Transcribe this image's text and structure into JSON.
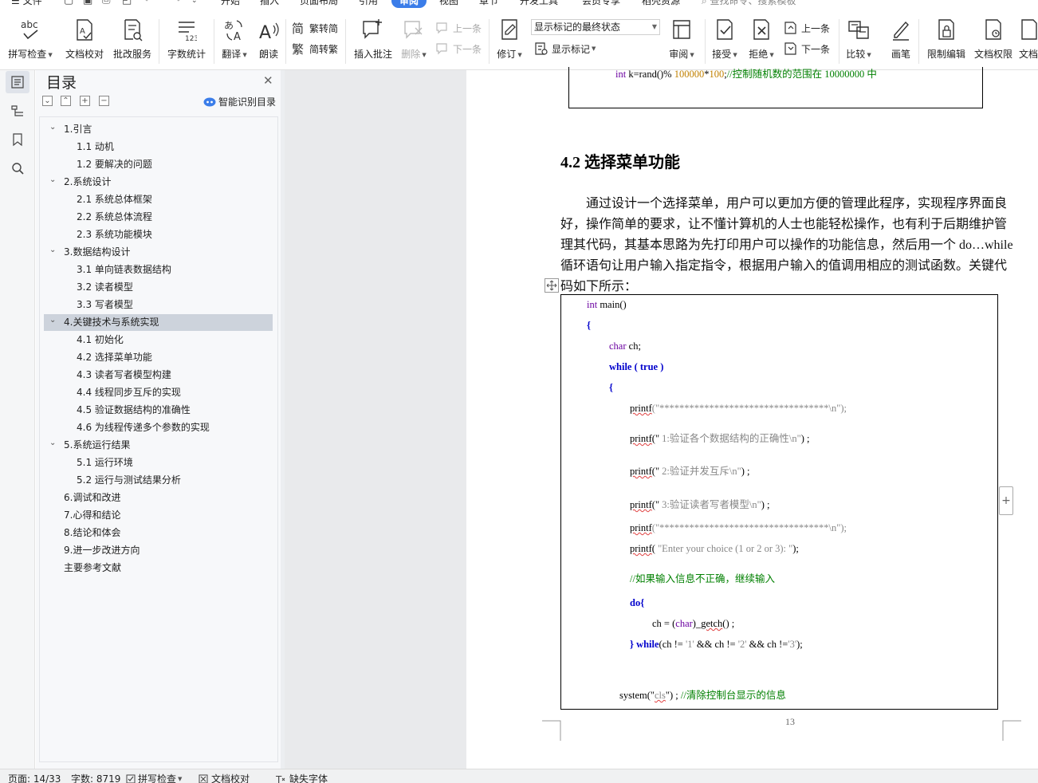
{
  "menu": {
    "tabs": [
      "文件",
      "开始",
      "插入",
      "页面布局",
      "引用",
      "审阅",
      "视图",
      "章节",
      "开发工具",
      "会员专享",
      "稻壳资源"
    ],
    "active_tab": "审阅",
    "search_placeholder": "查找命令、搜索模板"
  },
  "ribbon": {
    "spell_check": "拼写检查",
    "doc_proof": "文档校对",
    "revise_service": "批改服务",
    "word_count": "字数统计",
    "translate": "翻译",
    "read_aloud": "朗读",
    "trad_to_simp": "繁转简",
    "simp_to_trad": "简转繁",
    "insert_comment": "插入批注",
    "delete": "删除",
    "prev_comment": "上一条",
    "next_comment": "下一条",
    "track_changes": "修订",
    "markup_state": "显示标记的最终状态",
    "show_markup": "显示标记",
    "review": "审阅",
    "accept": "接受",
    "reject": "拒绝",
    "prev_change": "上一条",
    "next_change": "下一条",
    "compare": "比较",
    "pen": "画笔",
    "restrict_edit": "限制编辑",
    "doc_permission": "文档权限",
    "doc_cut": "文档"
  },
  "toc": {
    "title": "目录",
    "smart_label": "智能识别目录",
    "items": [
      {
        "text": "1.引言",
        "level": 1,
        "expanded": true
      },
      {
        "text": "1.1 动机",
        "level": 2
      },
      {
        "text": "1.2  要解决的问题",
        "level": 2
      },
      {
        "text": "2.系统设计",
        "level": 1,
        "expanded": true
      },
      {
        "text": "2.1 系统总体框架",
        "level": 2
      },
      {
        "text": "2.2  系统总体流程",
        "level": 2
      },
      {
        "text": "2.3  系统功能模块",
        "level": 2
      },
      {
        "text": "3.数据结构设计",
        "level": 1,
        "expanded": true
      },
      {
        "text": "3.1 单向链表数据结构",
        "level": 2
      },
      {
        "text": "3.2 读者模型",
        "level": 2
      },
      {
        "text": "3.3 写者模型",
        "level": 2
      },
      {
        "text": "4.关键技术与系统实现",
        "level": 1,
        "expanded": true,
        "selected": true
      },
      {
        "text": "4.1 初始化",
        "level": 2
      },
      {
        "text": "4.2 选择菜单功能",
        "level": 2
      },
      {
        "text": "4.3 读者写者模型构建",
        "level": 2
      },
      {
        "text": "4.4 线程同步互斥的实现",
        "level": 2
      },
      {
        "text": "4.5 验证数据结构的准确性",
        "level": 2
      },
      {
        "text": "4.6 为线程传递多个参数的实现",
        "level": 2
      },
      {
        "text": "5.系统运行结果",
        "level": 1,
        "expanded": true
      },
      {
        "text": "5.1 运行环境",
        "level": 2
      },
      {
        "text": "5.2 运行与测试结果分析",
        "level": 2
      },
      {
        "text": "6.调试和改进",
        "level": 1
      },
      {
        "text": "7.心得和结论",
        "level": 1
      },
      {
        "text": "8.结论和体会",
        "level": 1
      },
      {
        "text": "9.进一步改进方向",
        "level": 1
      },
      {
        "text": "主要参考文献",
        "level": 1
      }
    ]
  },
  "document": {
    "top_code": {
      "a": "int",
      "b": " k=rand()% ",
      "c": "100000",
      "d": "*",
      "e": "100",
      "f": ";",
      "g": "//控制随机数的范围在 10000000 中"
    },
    "heading": "4.2 选择菜单功能",
    "paragraph_lines": [
      "　　通过设计一个选择菜单，用户可以更加方便的管理此程序，实现程序界面良",
      "好，操作简单的要求，让不懂计算机的人士也能轻松操作，也有利于后期维护管",
      "理其代码，其基本思路为先打印用户可以操作的功能信息，然后用一个 do…while",
      "循环语句让用户输入指定指令，根据用户输入的值调用相应的测试函数。关键代",
      "码如下所示："
    ],
    "code": {
      "main_int": "int",
      "main_name": " main()",
      "brace_open": "{",
      "char_kw": "char",
      "char_var": " ch;",
      "while_kw": "while",
      "while_cond": " ( true )",
      "inner_brace": "{",
      "printf": "printf",
      "stars": "(\"**********************************\\n\");",
      "p1_open": "(\"",
      "p1_text": "          1:验证各个数据结构的正确性\\n\"",
      "p1_close": ") ;",
      "p2_open": "(\"",
      "p2_text": "          2:验证并发互斥\\n\"",
      "p2_close": ") ;",
      "p3_open": "(\"",
      "p3_text": "          3:验证读者写者模型\\n\"",
      "p3_close": ") ;",
      "p5_open": "( ",
      "p5_text": "\"Enter your choice (1 or 2 or 3): \"",
      "p5_close": ");",
      "comment_input": "//如果输入信息不正确，继续输入",
      "do_kw": "do{",
      "getch_a": "ch = (",
      "getch_b": "char",
      "getch_c": ")_",
      "getch_d": "getch",
      "getch_e": "() ;",
      "dowhile_a": "} ",
      "dowhile_b": "while",
      "dowhile_c": "(ch != ",
      "dowhile_d": "'1'",
      "dowhile_e": " && ch != ",
      "dowhile_f": "'2'",
      "dowhile_g": " && ch !=",
      "dowhile_h": "'3'",
      "dowhile_i": ");",
      "system_a": "system(\"",
      "system_b": "cls",
      "system_c": "\") ; ",
      "system_d": "//清除控制台显示的信息"
    },
    "page_number": "13"
  },
  "status": {
    "page": "页面: 14/33",
    "words": "字数: 8719",
    "spell": "拼写检查",
    "proof": "文档校对",
    "missing_font": "缺失字体"
  },
  "colors": {
    "accent": "#3b7de9",
    "keyword": "#0000cc",
    "comment": "#008000",
    "type": "#6a00a0"
  }
}
